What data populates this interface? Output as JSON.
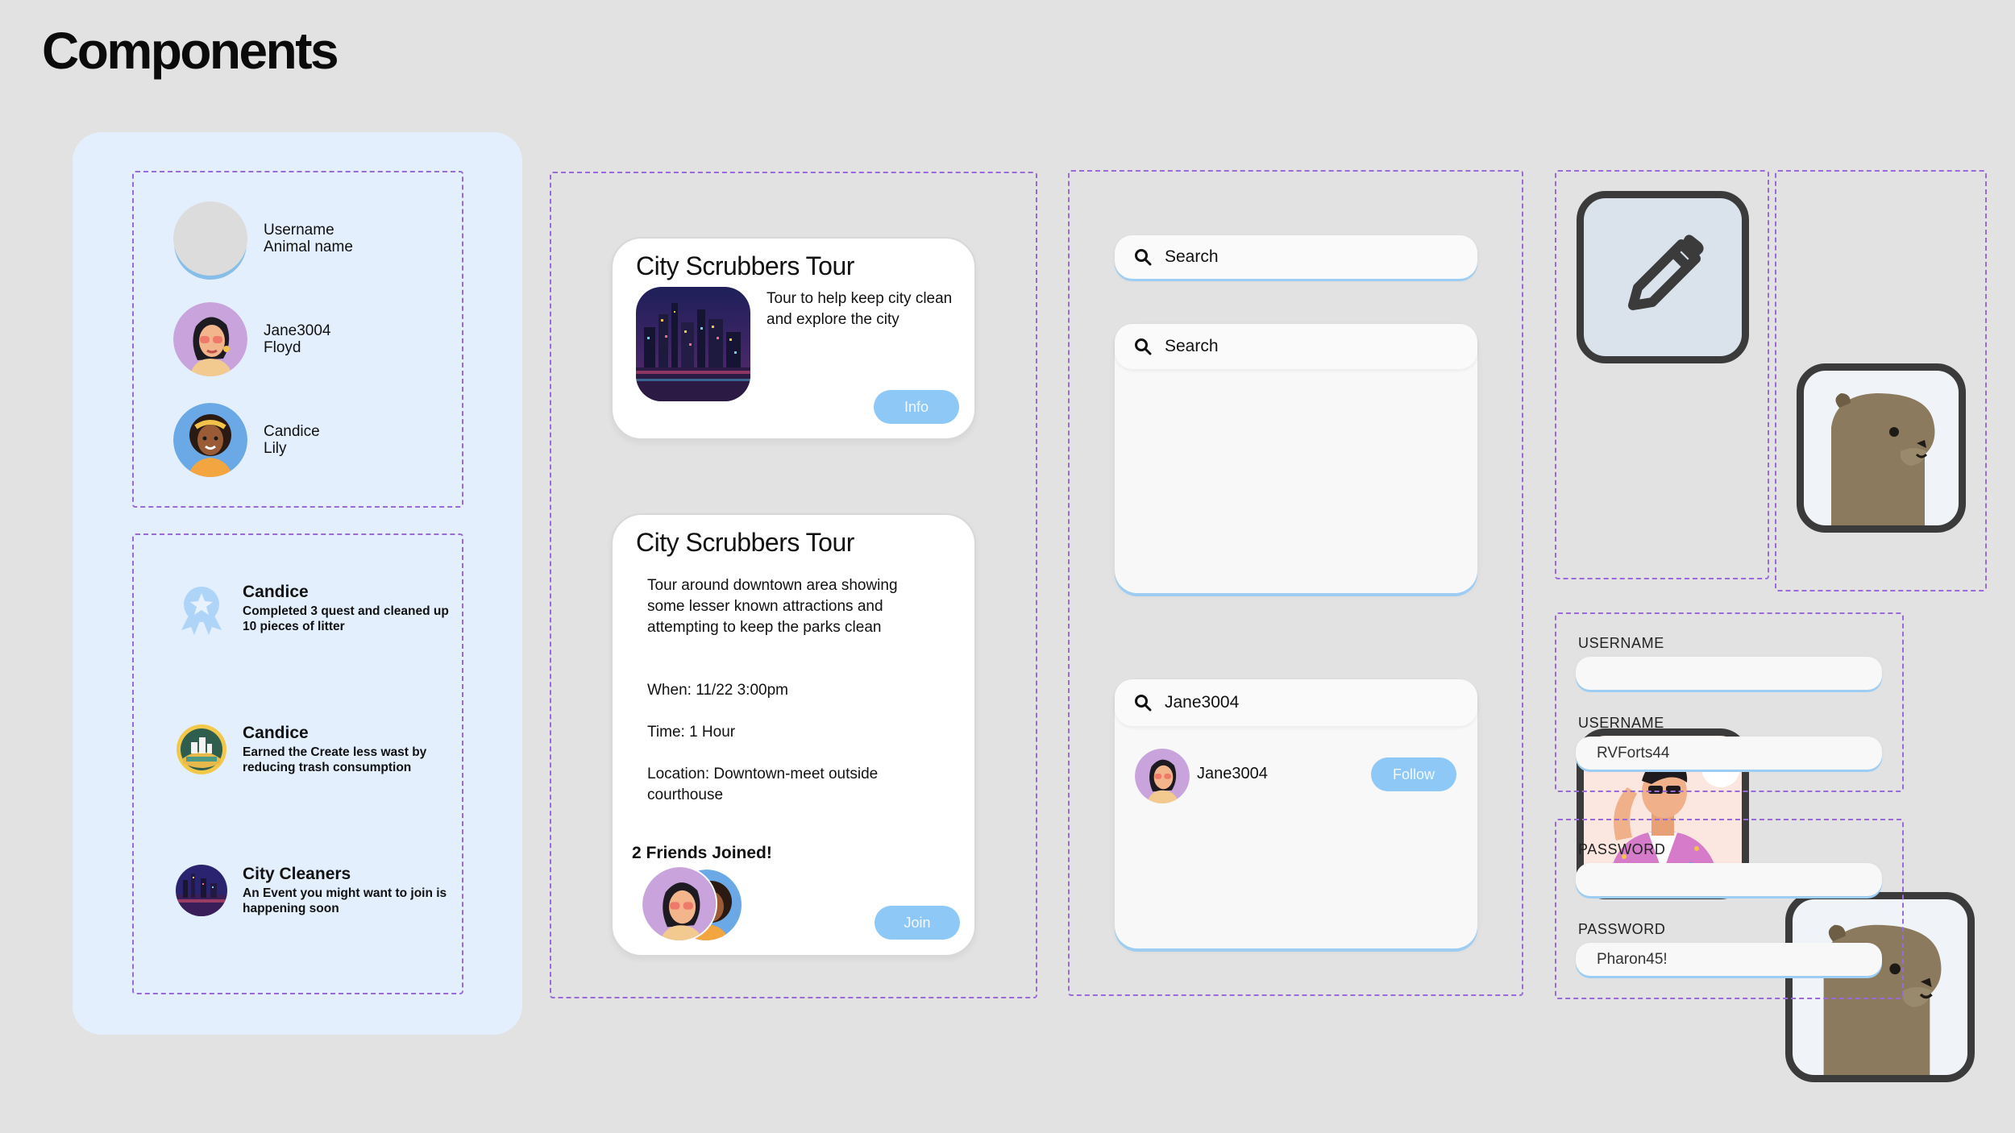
{
  "page": {
    "title": "Components"
  },
  "user_list": [
    {
      "name": "Username",
      "animal": "Animal name",
      "avatar": "blank"
    },
    {
      "name": "Jane3004",
      "animal": "Floyd",
      "avatar": "woman-sunglasses"
    },
    {
      "name": "Candice",
      "animal": "Lily",
      "avatar": "woman-headband"
    }
  ],
  "notifications": [
    {
      "title": "Candice",
      "body": "Completed 3 quest and cleaned up 10 pieces of litter",
      "icon": "award-ribbon-icon"
    },
    {
      "title": "Candice",
      "body": "Earned the Create less wast by reducing trash consumption",
      "icon": "badge-icon"
    },
    {
      "title": "City Cleaners",
      "body": "An Event you might want to join is happening soon",
      "icon": "city-night-icon"
    }
  ],
  "tour_card_small": {
    "title": "City Scrubbers Tour",
    "description": "Tour to help keep city clean and explore the city",
    "button": "Info"
  },
  "tour_card_large": {
    "title": "City Scrubbers Tour",
    "description": "Tour around downtown area showing some lesser known attractions and attempting to keep the parks clean",
    "when": "When: 11/22 3:00pm",
    "time": "Time: 1 Hour",
    "location": "Location: Downtown-meet outside courthouse",
    "friends": "2 Friends Joined!",
    "button": "Join"
  },
  "search": {
    "bar1": "Search",
    "bar2": "Search",
    "bar3": "Jane3004",
    "result_name": "Jane3004",
    "follow": "Follow"
  },
  "tiles": [
    "pencil-icon",
    "otter-icon",
    "man-sunglasses",
    "otter-icon"
  ],
  "form1": {
    "label1": "USERNAME",
    "value1": "",
    "label2": "USERNAME",
    "value2": "RVForts44"
  },
  "form2": {
    "label1": "PASSWORD",
    "value1": "",
    "label2": "PASSWORD",
    "value2": "Pharon45!"
  },
  "colors": {
    "accent": "#8ec8f6",
    "dashed": "#9a6ad8",
    "panel": "#e3effd",
    "tile_border": "#3b3b3b"
  }
}
